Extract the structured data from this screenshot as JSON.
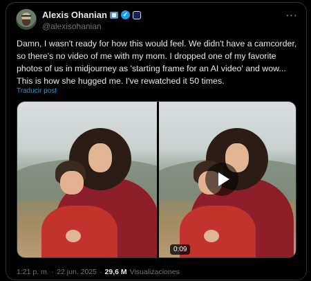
{
  "author": {
    "name": "Alexis Ohanian",
    "handle": "@alexisohanian",
    "icons": [
      "flag-icon",
      "verified-icon",
      "affiliate-badge-icon"
    ]
  },
  "tweet": {
    "text": "Damn, I wasn't ready for how this would feel. We didn't have a camcorder, so there's no video of me with my mom. I dropped one of my favorite photos of us in midjourney as 'starting frame for an AI video' and wow... This is how she hugged me. I've rewatched it 50 times.",
    "translate_label": "Traducir post"
  },
  "media": {
    "video_duration": "0:09"
  },
  "meta": {
    "time": "1:21 p. m.",
    "separator": "·",
    "date": "22 jun. 2025",
    "views_count": "29,6 M",
    "views_label": "Visualizaciones"
  },
  "colors": {
    "background": "#000000",
    "text": "#e7e9ea",
    "muted": "#71767b",
    "accent": "#1d9bf0",
    "border": "#2f3336"
  }
}
